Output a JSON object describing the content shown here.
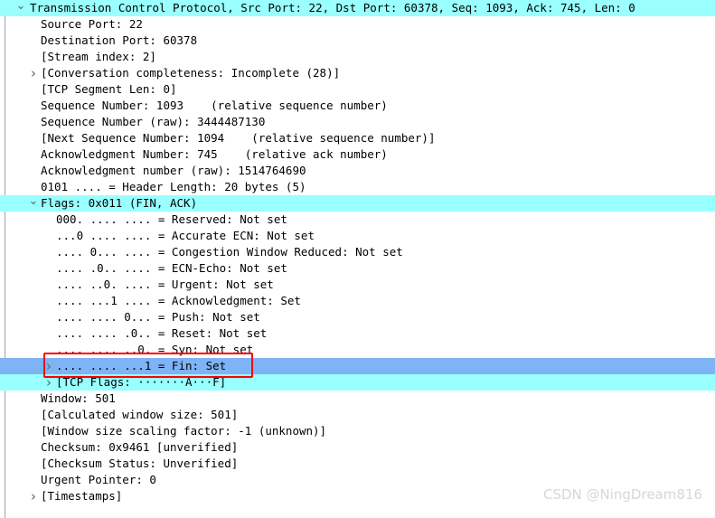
{
  "pane": {
    "name": "Wireshark packet details tree",
    "colors": {
      "highlight_cyan": "#99ffff",
      "selection_blue": "#7eb3f5",
      "annotation_red": "#ff0000",
      "text": "#000000",
      "twisty": "#5c6670",
      "guide_line": "#9aa4ae",
      "watermark": "#d7d7d7"
    }
  },
  "rows": [
    {
      "text": "Transmission Control Protocol, Src Port: 22, Dst Port: 60378, Seq: 1093, Ack: 745, Len: 0",
      "level": 0,
      "twisty": "open",
      "highlight": "cyan"
    },
    {
      "text": "Source Port: 22",
      "level": 1,
      "twisty": "none",
      "highlight": "none"
    },
    {
      "text": "Destination Port: 60378",
      "level": 1,
      "twisty": "none",
      "highlight": "none"
    },
    {
      "text": "[Stream index: 2]",
      "level": 1,
      "twisty": "none",
      "highlight": "none"
    },
    {
      "text": "[Conversation completeness: Incomplete (28)]",
      "level": 1,
      "twisty": "closed",
      "highlight": "none"
    },
    {
      "text": "[TCP Segment Len: 0]",
      "level": 1,
      "twisty": "none",
      "highlight": "none"
    },
    {
      "text": "Sequence Number: 1093    (relative sequence number)",
      "level": 1,
      "twisty": "none",
      "highlight": "none"
    },
    {
      "text": "Sequence Number (raw): 3444487130",
      "level": 1,
      "twisty": "none",
      "highlight": "none"
    },
    {
      "text": "[Next Sequence Number: 1094    (relative sequence number)]",
      "level": 1,
      "twisty": "none",
      "highlight": "none"
    },
    {
      "text": "Acknowledgment Number: 745    (relative ack number)",
      "level": 1,
      "twisty": "none",
      "highlight": "none"
    },
    {
      "text": "Acknowledgment number (raw): 1514764690",
      "level": 1,
      "twisty": "none",
      "highlight": "none"
    },
    {
      "text": "0101 .... = Header Length: 20 bytes (5)",
      "level": 1,
      "twisty": "none",
      "highlight": "none"
    },
    {
      "text": "Flags: 0x011 (FIN, ACK)",
      "level": 1,
      "twisty": "open",
      "highlight": "cyan"
    },
    {
      "text": "000. .... .... = Reserved: Not set",
      "level": 2,
      "twisty": "none",
      "highlight": "none"
    },
    {
      "text": "...0 .... .... = Accurate ECN: Not set",
      "level": 2,
      "twisty": "none",
      "highlight": "none"
    },
    {
      "text": ".... 0... .... = Congestion Window Reduced: Not set",
      "level": 2,
      "twisty": "none",
      "highlight": "none"
    },
    {
      "text": ".... .0.. .... = ECN-Echo: Not set",
      "level": 2,
      "twisty": "none",
      "highlight": "none"
    },
    {
      "text": ".... ..0. .... = Urgent: Not set",
      "level": 2,
      "twisty": "none",
      "highlight": "none"
    },
    {
      "text": ".... ...1 .... = Acknowledgment: Set",
      "level": 2,
      "twisty": "none",
      "highlight": "none"
    },
    {
      "text": ".... .... 0... = Push: Not set",
      "level": 2,
      "twisty": "none",
      "highlight": "none"
    },
    {
      "text": ".... .... .0.. = Reset: Not set",
      "level": 2,
      "twisty": "none",
      "highlight": "none"
    },
    {
      "text": ".... .... ..0. = Syn: Not set",
      "level": 2,
      "twisty": "none",
      "highlight": "none"
    },
    {
      "text": ".... .... ...1 = Fin: Set",
      "level": 2,
      "twisty": "closed",
      "highlight": "blue"
    },
    {
      "text": "[TCP Flags: ·······A···F]",
      "level": 2,
      "twisty": "closed",
      "highlight": "cyan"
    },
    {
      "text": "Window: 501",
      "level": 1,
      "twisty": "none",
      "highlight": "none"
    },
    {
      "text": "[Calculated window size: 501]",
      "level": 1,
      "twisty": "none",
      "highlight": "none"
    },
    {
      "text": "[Window size scaling factor: -1 (unknown)]",
      "level": 1,
      "twisty": "none",
      "highlight": "none"
    },
    {
      "text": "Checksum: 0x9461 [unverified]",
      "level": 1,
      "twisty": "none",
      "highlight": "none"
    },
    {
      "text": "[Checksum Status: Unverified]",
      "level": 1,
      "twisty": "none",
      "highlight": "none"
    },
    {
      "text": "Urgent Pointer: 0",
      "level": 1,
      "twisty": "none",
      "highlight": "none"
    },
    {
      "text": "[Timestamps]",
      "level": 1,
      "twisty": "closed",
      "highlight": "none"
    }
  ],
  "annotation": {
    "name": "fin-flag-red-highlight-box",
    "target_row_text": ".... .... ...1 = Fin: Set"
  },
  "watermark": {
    "text": "CSDN @NingDream816"
  }
}
